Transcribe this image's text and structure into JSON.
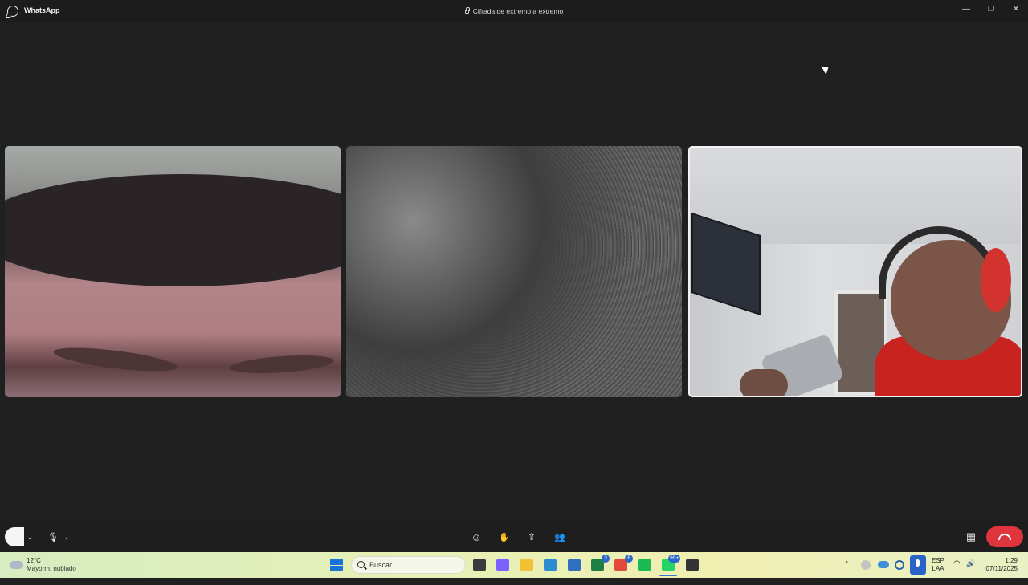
{
  "titlebar": {
    "app_name": "WhatsApp",
    "encryption": "Cifrada de extremo a extremo",
    "minimize": "—",
    "restore": "❐",
    "close": "✕"
  },
  "call": {
    "participants": [
      {
        "label": "participant-video-1"
      },
      {
        "label": "participant-video-2"
      },
      {
        "label": "participant-video-3",
        "active_speaker": true
      }
    ]
  },
  "controls": {
    "camera_chevron": "⌄",
    "mic_icon": "🎙",
    "mic_chevron": "⌄",
    "emoji_icon": "☺",
    "raise_hand_icon": "✋",
    "share_screen_icon": "⇪",
    "participants_icon": "👥",
    "layout_icon": "▦"
  },
  "taskbar": {
    "weather_temp": "12°C",
    "weather_desc": "Mayorm. nublado",
    "search_placeholder": "Buscar",
    "apps": [
      {
        "name": "file-explorer-icon",
        "color": "#3b3b3b"
      },
      {
        "name": "copilot-icon",
        "color": "#7b61ff"
      },
      {
        "name": "folder-icon",
        "color": "#f2c033"
      },
      {
        "name": "edge-icon",
        "color": "#2c8ccf"
      },
      {
        "name": "store-icon",
        "color": "#2f6fc2"
      },
      {
        "name": "excel-icon",
        "color": "#1e7f45",
        "badge": "3"
      },
      {
        "name": "chrome-icon",
        "color": "#e04a3a",
        "badge": "F"
      },
      {
        "name": "spotify-icon",
        "color": "#1db954"
      },
      {
        "name": "whatsapp-icon",
        "color": "#25d366",
        "badge": "99+"
      },
      {
        "name": "app-icon",
        "color": "#333333"
      }
    ],
    "tray_chevron": "^",
    "lang_line1": "ESP",
    "lang_line2": "LAA",
    "wifi_icon": "◠",
    "volume_icon": "🔊",
    "time": "1:29",
    "date": "07/11/2025"
  },
  "colors": {
    "background": "#202020",
    "end_call": "#e0353f",
    "accent": "#3a76d8"
  }
}
